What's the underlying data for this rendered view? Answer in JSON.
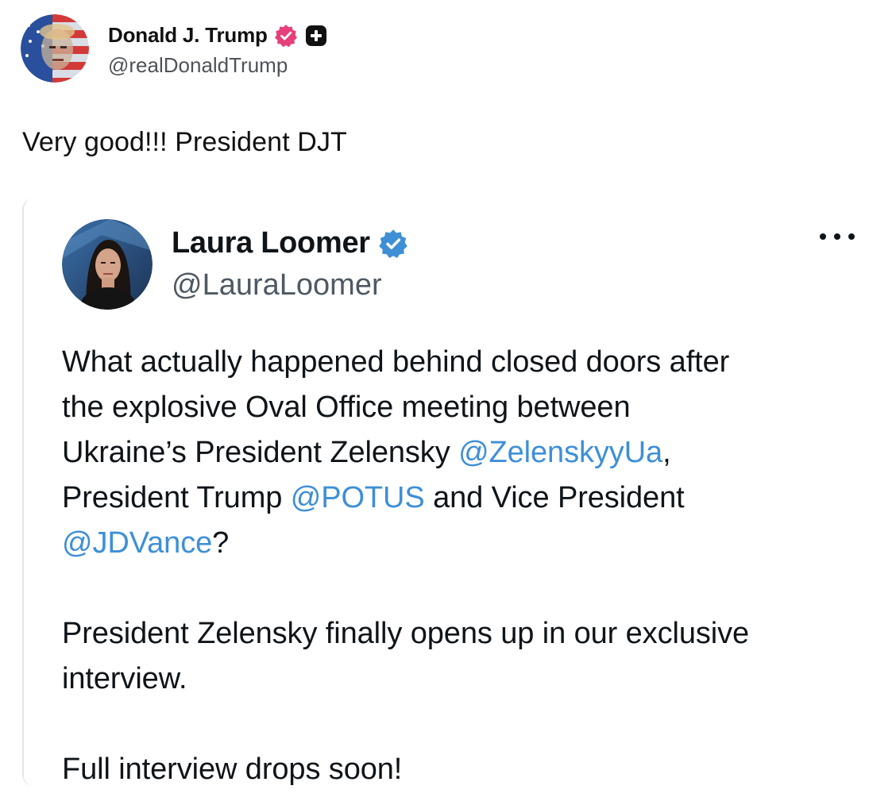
{
  "post": {
    "author": {
      "display_name": "Donald J. Trump",
      "handle": "@realDonaldTrump",
      "avatar_icon": "flag-portrait-avatar",
      "verified_icon": "verified-badge-icon",
      "badge_color": "#e5407a",
      "plus_icon": "plus-badge-icon"
    },
    "text": "Very good!!! President DJT"
  },
  "quote": {
    "author": {
      "display_name": "Laura Loomer",
      "handle": "@LauraLoomer",
      "avatar_icon": "portrait-avatar",
      "verified_icon": "verified-badge-icon",
      "badge_color": "#3e8fd6"
    },
    "more_icon": "more-options-icon",
    "mention_color": "#3e8fd6",
    "body": {
      "line1": "What actually happened behind closed doors after",
      "line2": "the explosive Oval Office meeting between",
      "line3_pre": "Ukraine’s President Zelensky ",
      "mention_zelensky": "@ZelenskyyUa",
      "line3_post": ",",
      "line4_pre": "President Trump ",
      "mention_potus": "@POTUS",
      "line4_post": " and Vice President",
      "mention_jdvance": "@JDVance",
      "line5_post": "?",
      "para2_line1": "President Zelensky finally opens up in our exclusive",
      "para2_line2": "interview.",
      "para3_line1": "Full interview drops soon!"
    }
  }
}
